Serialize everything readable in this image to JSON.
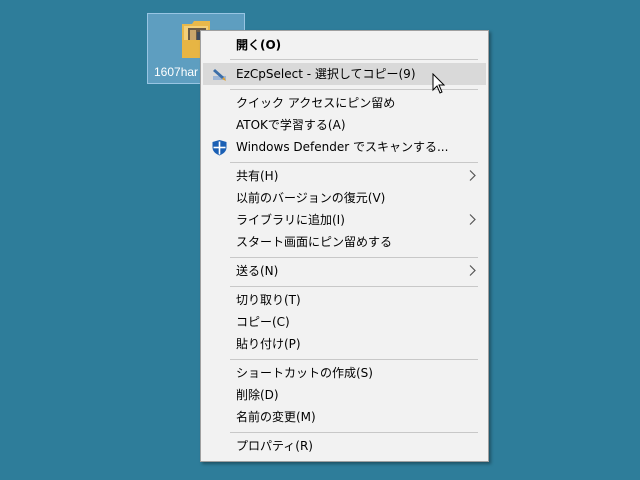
{
  "desktop": {
    "folder_label": "1607har"
  },
  "menu": {
    "items": [
      {
        "label": "開く(O)",
        "bold": true
      },
      {
        "label": "EzCpSelect - 選択してコピー(9)",
        "icon": "ezcpselect-icon"
      },
      {
        "label": "クイック アクセスにピン留め"
      },
      {
        "label": "ATOKで学習する(A)"
      },
      {
        "label": "Windows Defender でスキャンする...",
        "icon": "defender-shield-icon"
      },
      {
        "label": "共有(H)",
        "submenu": true
      },
      {
        "label": "以前のバージョンの復元(V)"
      },
      {
        "label": "ライブラリに追加(I)",
        "submenu": true
      },
      {
        "label": "スタート画面にピン留めする"
      },
      {
        "label": "送る(N)",
        "submenu": true
      },
      {
        "label": "切り取り(T)"
      },
      {
        "label": "コピー(C)"
      },
      {
        "label": "貼り付け(P)"
      },
      {
        "label": "ショートカットの作成(S)"
      },
      {
        "label": "削除(D)"
      },
      {
        "label": "名前の変更(M)"
      },
      {
        "label": "プロパティ(R)"
      }
    ]
  },
  "colors": {
    "desktop_bg": "#2e7d9a",
    "menu_bg": "#f2f2f2",
    "highlight": "#d9d9d9"
  }
}
